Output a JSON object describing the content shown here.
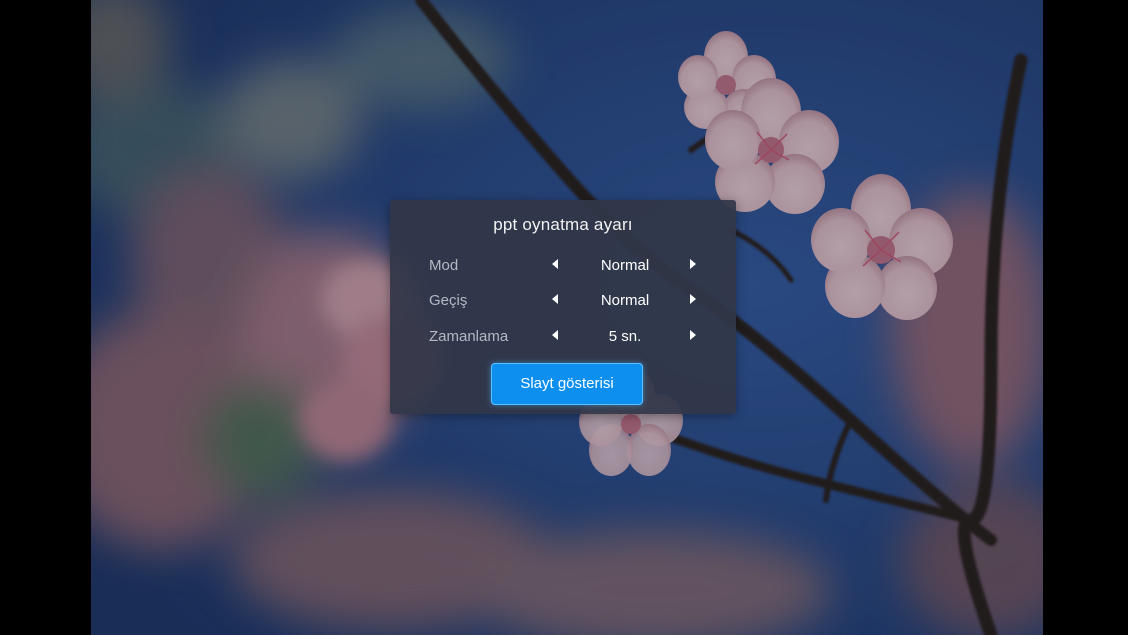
{
  "dialog": {
    "title": "ppt oynatma ayarı",
    "rows": [
      {
        "label": "Mod",
        "value": "Normal"
      },
      {
        "label": "Geçiş",
        "value": "Normal"
      },
      {
        "label": "Zamanlama",
        "value": "5 sn."
      }
    ],
    "button_label": "Slayt gösterisi"
  },
  "colors": {
    "panel_bg": "#323748",
    "button_bg": "#0d8ff0",
    "sky": "#2b4d8a",
    "blossom": "#e8c4cc"
  },
  "icons": {
    "prev": "triangle-left-icon",
    "next": "triangle-right-icon"
  }
}
